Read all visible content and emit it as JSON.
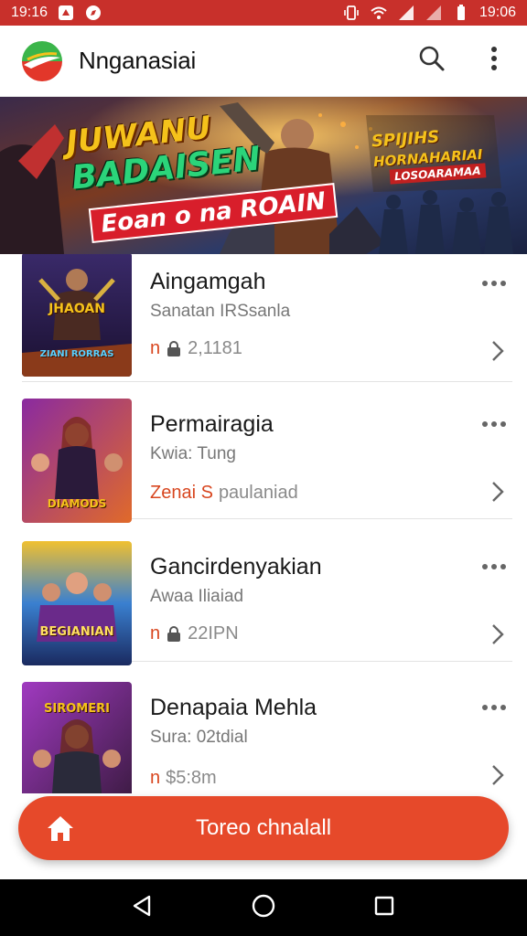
{
  "status_bar": {
    "time_left": "19:16",
    "time_right": "19:06"
  },
  "app": {
    "title": "Nnganasiai"
  },
  "banner": {
    "line1": "JUWANU",
    "line2": "BADAISEN",
    "line3": "Eoan o na ROAIN",
    "right_line1": "SPIJIHS",
    "right_line2": "HORNAHARIAI",
    "right_line3": "LOSOARAMAA"
  },
  "list": [
    {
      "title": "Aingamgah",
      "subtitle": "Sanatan IRSsanla",
      "meta_accent": "n",
      "meta_value": "2,1181",
      "thumb_label": "JHAOAN",
      "thumb_label2": "ZIANI RORRAS"
    },
    {
      "title": "Permairagia",
      "subtitle": "Kwia: Tung",
      "meta_accent": "Zenai S",
      "meta_value": "paulaniad",
      "thumb_label": "DIAMODS",
      "thumb_label2": ""
    },
    {
      "title": "Gancirdenyakian",
      "subtitle": "Awaa Iliaiad",
      "meta_accent": "n",
      "meta_value": "22IPN",
      "thumb_label": "BEGIANIAN",
      "thumb_label2": ""
    },
    {
      "title": "Denapaia Mehla",
      "subtitle": "Sura: 02tdial",
      "meta_accent": "n",
      "meta_value": "$5:8m",
      "thumb_label": "SIROMERI",
      "thumb_label2": ""
    }
  ],
  "cta": {
    "label": "Toreo chnalall"
  },
  "colors": {
    "status_bar": "#c8302b",
    "accent": "#e6492a",
    "meta_accent": "#d8461f"
  },
  "icons": {
    "search": "search-icon",
    "more": "more-vertical-icon",
    "row_more": "more-horizontal-icon",
    "chevron": "chevron-right-icon",
    "home": "home-icon",
    "back": "back-triangle-icon",
    "home_nav": "home-circle-icon",
    "recents": "recents-square-icon"
  }
}
